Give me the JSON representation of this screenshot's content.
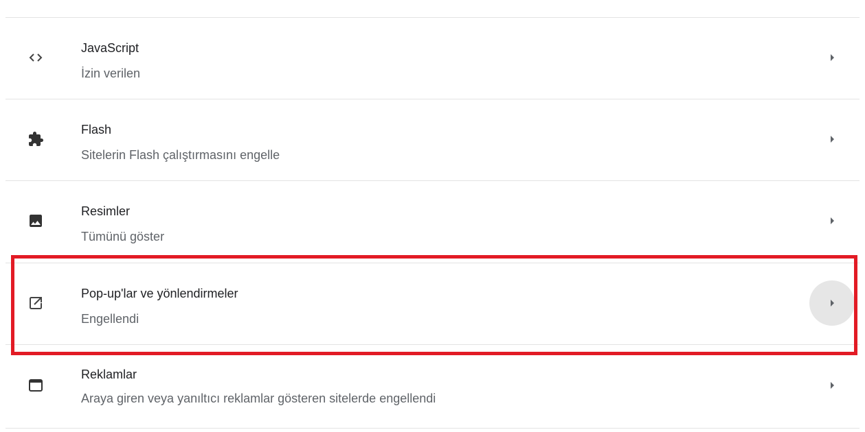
{
  "settings": {
    "rows": [
      {
        "title": "JavaScript",
        "subtitle": "İzin verilen",
        "icon": "code-icon"
      },
      {
        "title": "Flash",
        "subtitle": "Sitelerin Flash çalıştırmasını engelle",
        "icon": "puzzle-icon"
      },
      {
        "title": "Resimler",
        "subtitle": "Tümünü göster",
        "icon": "image-icon"
      },
      {
        "title": "Pop-up'lar ve yönlendirmeler",
        "subtitle": "Engellendi",
        "icon": "open-in-new-icon"
      },
      {
        "title": "Reklamlar",
        "subtitle": "Araya giren veya yanıltıcı reklamlar gösteren sitelerde engellendi",
        "icon": "browser-window-icon"
      }
    ]
  },
  "colors": {
    "highlight_border": "#e21b25",
    "title_text": "#202124",
    "subtitle_text": "#5f6368",
    "icon": "#444444",
    "hover_circle": "#e6e6e6"
  }
}
